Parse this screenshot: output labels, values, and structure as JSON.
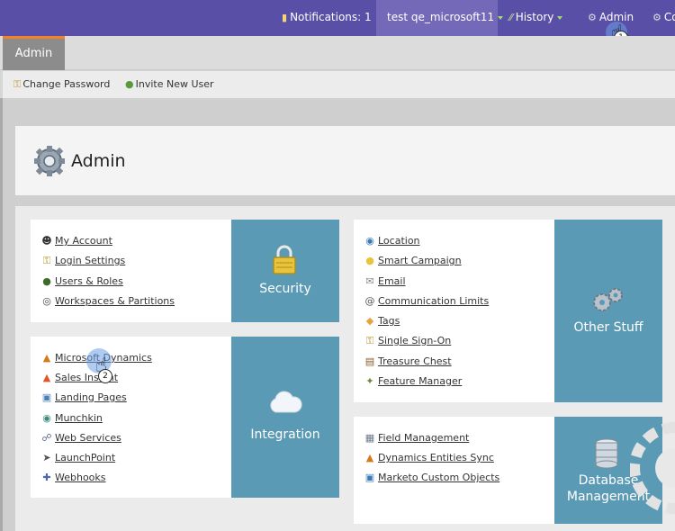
{
  "topbar": {
    "notifications": "Notifications: 1",
    "user": "test qe_microsoft11",
    "history": "History",
    "admin": "Admin",
    "cut": "Co"
  },
  "tabs": {
    "admin": "Admin"
  },
  "subbar": {
    "change_password": "Change Password",
    "invite_user": "Invite New User"
  },
  "header": {
    "title": "Admin"
  },
  "security": {
    "tile": "Security",
    "links": [
      "My Account",
      "Login Settings",
      "Users & Roles",
      "Workspaces & Partitions"
    ]
  },
  "integration": {
    "tile": "Integration",
    "links": [
      "Microsoft Dynamics",
      "Sales Insight",
      "Landing Pages",
      "Munchkin",
      "Web Services",
      "LaunchPoint",
      "Webhooks"
    ]
  },
  "other": {
    "tile": "Other Stuff",
    "links": [
      "Location",
      "Smart Campaign",
      "Email",
      "Communication Limits",
      "Tags",
      "Single Sign-On",
      "Treasure Chest",
      "Feature Manager"
    ]
  },
  "database": {
    "tile_line1": "Database",
    "tile_line2": "Management",
    "links": [
      "Field Management",
      "Dynamics Entities Sync",
      "Marketo Custom Objects"
    ]
  },
  "cursor_badges": {
    "first": "1",
    "second": "2"
  },
  "colors": {
    "topbar": "#5a4fa6",
    "tile": "#5b9ab5",
    "tab_accent": "#f0822a"
  }
}
